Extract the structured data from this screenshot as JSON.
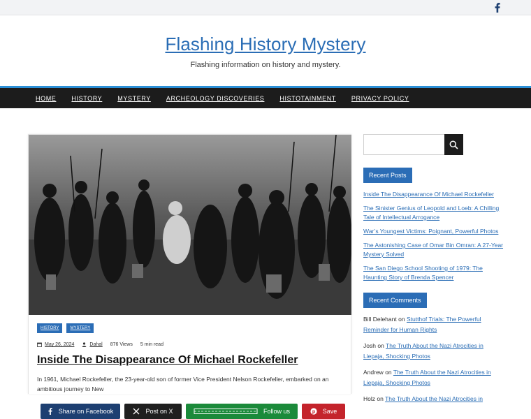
{
  "site": {
    "title": "Flashing History Mystery",
    "description": "Flashing information on history and mystery."
  },
  "nav": [
    "HOME",
    "HISTORY",
    "MYSTERY",
    "ARCHEOLOGY DISCOVERIES",
    "HISTOTAINMENT",
    "PRIVACY POLICY"
  ],
  "post": {
    "tags": [
      "HISTORY",
      "MYSTERY"
    ],
    "date": "May 26, 2024",
    "author": "Dahal",
    "views": "876 Views",
    "read_time": "5 min read",
    "title": "Inside The Disappearance Of Michael Rockefeller",
    "excerpt": "In 1961, Michael Rockefeller, the 23-year-old son of former Vice President Nelson Rockefeller, embarked on an ambitious journey to New"
  },
  "share": {
    "facebook": "Share on Facebook",
    "x": "Post on X",
    "follow": "Follow us",
    "save": "Save"
  },
  "sidebar": {
    "search_placeholder": "",
    "recent_posts_title": "Recent Posts",
    "recent_posts": [
      "Inside The Disappearance Of Michael Rockefeller",
      "The Sinister Genius of Leopold and Loeb: A Chilling Tale of Intellectual Arrogance",
      "War’s Youngest Victims: Poignant, Powerful Photos",
      "The Astonishing Case of Omar Bin Omran: A 27-Year Mystery Solved",
      "The San Diego School Shooting of 1979: The Haunting Story of Brenda Spencer"
    ],
    "recent_comments_title": "Recent Comments",
    "recent_comments": [
      {
        "author": "Bill Delehant",
        "on": "on",
        "post": "Stutthof Trials: The Powerful Reminder for Human Rights"
      },
      {
        "author": "Josh",
        "on": "on",
        "post": "The Truth About the Nazi Atrocities in Liepaja, Shocking Photos"
      },
      {
        "author": "Andrew",
        "on": "on",
        "post": "The Truth About the Nazi Atrocities in Liepaja, Shocking Photos"
      },
      {
        "author": "Holz",
        "on": "on",
        "post": "The Truth About the Nazi Atrocities in"
      }
    ]
  },
  "colors": {
    "accent": "#2b6db6",
    "nav_bg": "#1c1c1c",
    "facebook": "#1d3f71",
    "follow": "#1b8a3a",
    "save": "#c4232b"
  }
}
